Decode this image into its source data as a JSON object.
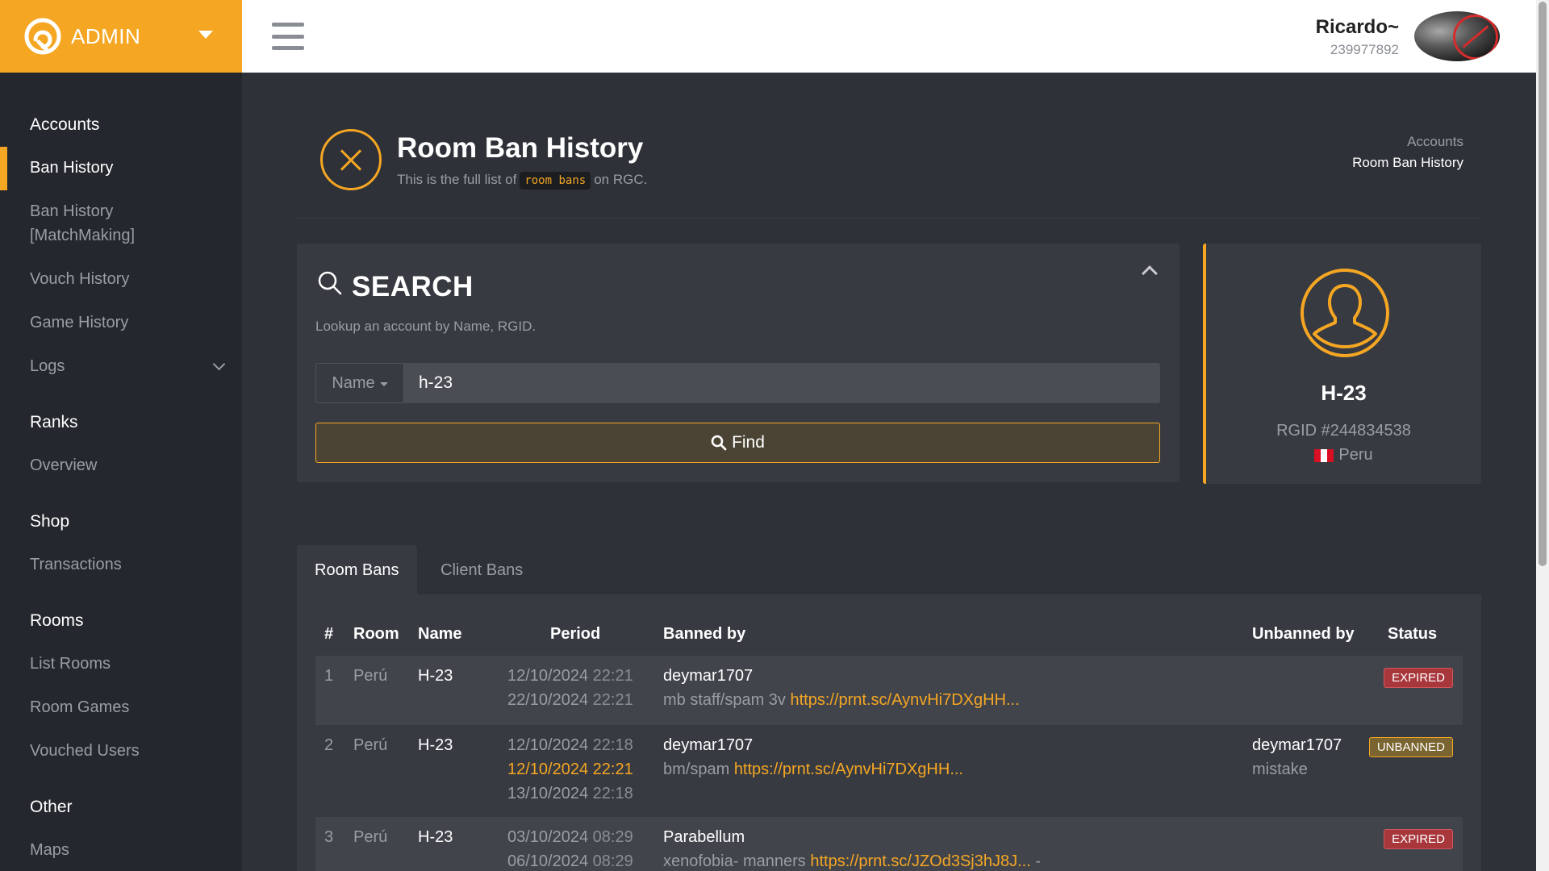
{
  "brand": {
    "name": "ADMIN"
  },
  "user": {
    "name": "Ricardo~",
    "id": "239977892"
  },
  "sidebar": {
    "sections": [
      {
        "title": "Accounts",
        "items": [
          "Ban History",
          "Ban History [MatchMaking]",
          "Vouch History",
          "Game History",
          "Logs"
        ]
      },
      {
        "title": "Ranks",
        "items": [
          "Overview"
        ]
      },
      {
        "title": "Shop",
        "items": [
          "Transactions"
        ]
      },
      {
        "title": "Rooms",
        "items": [
          "List Rooms",
          "Room Games",
          "Vouched Users"
        ]
      },
      {
        "title": "Other",
        "items": [
          "Maps"
        ]
      }
    ],
    "ban_history_mm_line1": "Ban History",
    "ban_history_mm_line2": "[MatchMaking]"
  },
  "page": {
    "title": "Room Ban History",
    "subtitle_pre": "This is the full list of",
    "subtitle_code": "room bans",
    "subtitle_post": "on RGC."
  },
  "breadcrumb": [
    "Accounts",
    "Room Ban History"
  ],
  "search": {
    "title": "SEARCH",
    "help": "Lookup an account by Name, RGID.",
    "select_value": "Name",
    "input_value": "h-23",
    "find_label": "Find"
  },
  "profile": {
    "name": "H-23",
    "rgid": "RGID #244834538",
    "country": "Peru"
  },
  "tabs": [
    {
      "label": "Room Bans",
      "active": true
    },
    {
      "label": "Client Bans",
      "active": false
    }
  ],
  "table": {
    "headers": [
      "#",
      "Room",
      "Name",
      "Period",
      "Banned by",
      "Unbanned by",
      "Status"
    ],
    "rows": [
      {
        "num": "1",
        "room": "Perú",
        "name": "H-23",
        "d1": "12/10/2024",
        "t1": "22:21",
        "d2": "22/10/2024",
        "t2": "22:21",
        "banned_by": "deymar1707",
        "reason": "mb staff/spam 3v",
        "link": "https://prnt.sc/AynvHi7DXgHH...",
        "status": "EXPIRED"
      },
      {
        "num": "2",
        "room": "Perú",
        "name": "H-23",
        "d1": "12/10/2024",
        "t1": "22:18",
        "d2": "12/10/2024",
        "t2": "22:21",
        "d3": "13/10/2024",
        "t3": "22:18",
        "banned_by": "deymar1707",
        "reason": "bm/spam",
        "link": "https://prnt.sc/AynvHi7DXgHH...",
        "unbanned_by": "deymar1707",
        "unban_reason": "mistake",
        "status": "UNBANNED"
      },
      {
        "num": "3",
        "room": "Perú",
        "name": "H-23",
        "d1": "03/10/2024",
        "t1": "08:29",
        "d2": "06/10/2024",
        "t2": "08:29",
        "banned_by": "Parabellum",
        "reason": "xenofobia- manners",
        "link": "https://prnt.sc/JZOd3Sj3hJ8J...",
        "reason_tail": "-",
        "status": "EXPIRED"
      }
    ]
  },
  "colors": {
    "accent": "#f5a623",
    "expired": "#a8373c",
    "unbanned": "#7a6430",
    "sidebar": "#24272d",
    "content": "#2e3138"
  },
  "icons": [
    "brand-logo-icon",
    "menu-icon",
    "search-icon",
    "chevron-up-icon",
    "chevron-down-icon",
    "ban-icon",
    "user-icon",
    "peru-flag-icon"
  ]
}
